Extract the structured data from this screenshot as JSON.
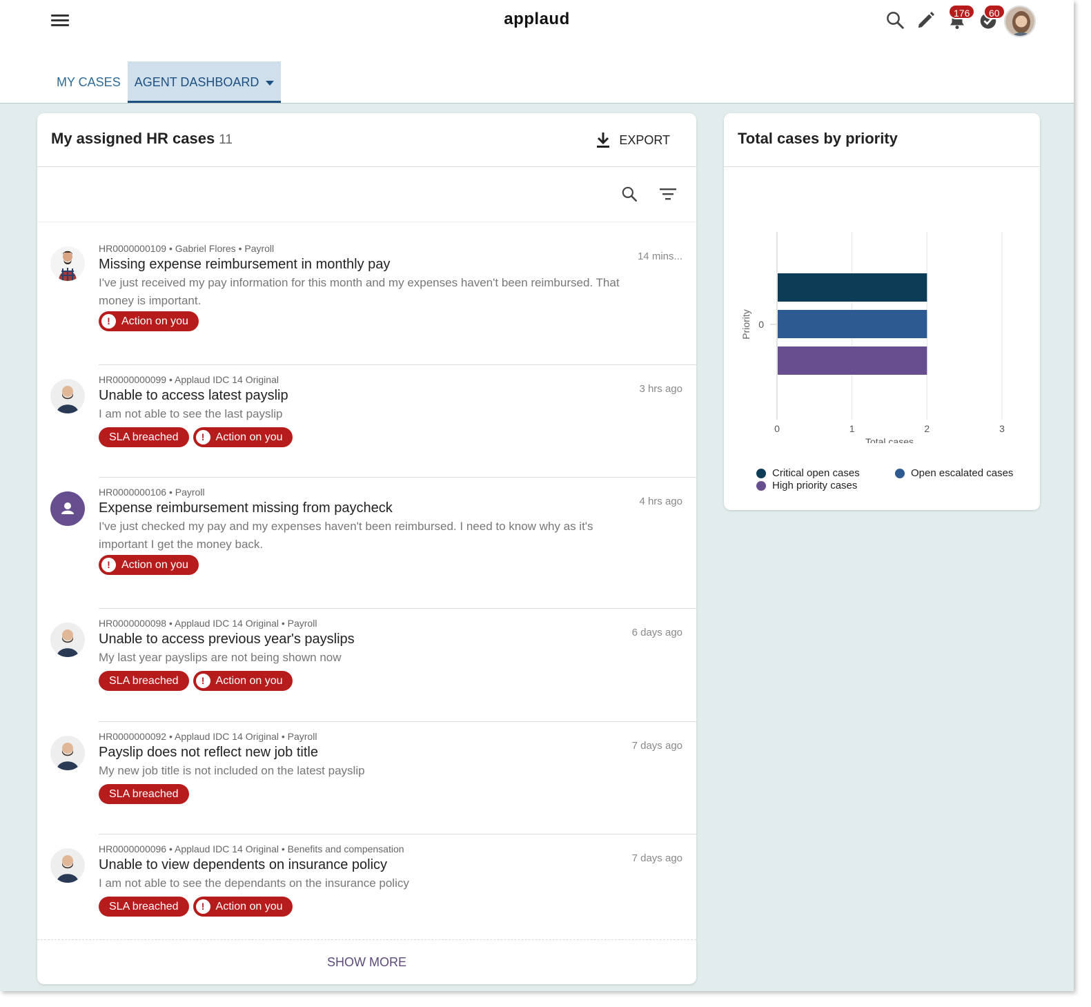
{
  "app": {
    "logo": "applaud"
  },
  "header": {
    "notifications_count": "176",
    "tasks_count": "60"
  },
  "tabs": [
    {
      "label": "MY CASES"
    },
    {
      "label": "AGENT DASHBOARD"
    }
  ],
  "cases_panel": {
    "title": "My assigned HR cases",
    "count": "11",
    "export_label": "EXPORT",
    "show_more_label": "SHOW MORE",
    "cases": [
      {
        "meta": "HR0000000109 • Gabriel Flores • Payroll",
        "title": "Missing expense reimbursement in monthly pay",
        "description": "I've just received my pay information for this month and my expenses haven't been reimbursed. That money is important.",
        "time": "14 mins...",
        "tags": [
          "Action on you"
        ]
      },
      {
        "meta": "HR0000000099 • Applaud IDC 14 Original",
        "title": "Unable to access latest payslip",
        "description": "I am not able to see the last payslip",
        "time": "3 hrs ago",
        "tags": [
          "SLA breached",
          "Action on you"
        ]
      },
      {
        "meta": "HR0000000106 • Payroll",
        "title": "Expense reimbursement missing from paycheck",
        "description": "I've just checked my pay and my expenses haven't been reimbursed. I need to know why as it's important I get the money back.",
        "time": "4 hrs ago",
        "tags": [
          "Action on you"
        ]
      },
      {
        "meta": "HR0000000098 • Applaud IDC 14 Original • Payroll",
        "title": "Unable to access previous year's payslips",
        "description": "My last year payslips are not being shown now",
        "time": "6 days ago",
        "tags": [
          "SLA breached",
          "Action on you"
        ]
      },
      {
        "meta": "HR0000000092 • Applaud IDC 14 Original • Payroll",
        "title": "Payslip does not reflect new job title",
        "description": "My new job title is not included on the latest payslip",
        "time": "7 days ago",
        "tags": [
          "SLA breached"
        ]
      },
      {
        "meta": "HR0000000096 • Applaud IDC 14 Original • Benefits and compensation",
        "title": "Unable to view dependents on insurance policy",
        "description": "I am not able to see the dependants on the insurance policy",
        "time": "7 days ago",
        "tags": [
          "SLA breached",
          "Action on you"
        ]
      }
    ]
  },
  "colors": {
    "badge_red": "#b71c1c",
    "critical": "#0d3d56",
    "escalated": "#2e5a92",
    "high": "#674e8f"
  },
  "chart_panel": {
    "title": "Total cases by priority"
  },
  "chart_data": {
    "type": "bar",
    "orientation": "horizontal",
    "categories": [
      "0"
    ],
    "series": [
      {
        "name": "Critical open cases",
        "values": [
          2
        ]
      },
      {
        "name": "Open escalated cases",
        "values": [
          2
        ]
      },
      {
        "name": "High priority cases",
        "values": [
          2
        ]
      }
    ],
    "xlabel": "Total cases",
    "ylabel": "Priority",
    "xlim": [
      0,
      3
    ],
    "xticks": [
      "0",
      "1",
      "2",
      "3"
    ],
    "grid": true,
    "legend_position": "bottom"
  }
}
